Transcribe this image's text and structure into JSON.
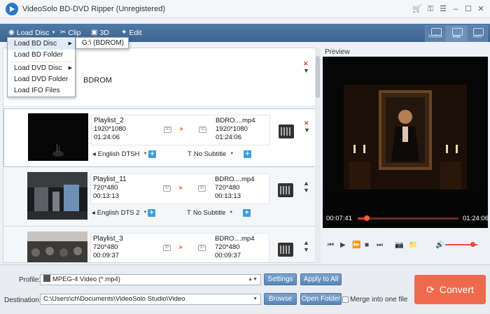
{
  "window": {
    "title": "VideoSolo BD-DVD Ripper (Unregistered)",
    "controls": [
      "cart-icon",
      "key-icon",
      "menu-icon",
      "minimize-icon",
      "maximize-icon",
      "close-icon"
    ]
  },
  "toolbar": {
    "load_disc": "Load Disc",
    "clip": "Clip",
    "three_d": "3D",
    "edit": "Edit",
    "accel": [
      {
        "label": "NVIDIA",
        "active": false
      },
      {
        "label": "Intel",
        "active": true
      },
      {
        "label": "AMD",
        "active": false
      }
    ]
  },
  "load_menu": {
    "items": [
      {
        "label": "Load BD Disc",
        "has_submenu": true
      },
      {
        "label": "Load BD Folder",
        "has_submenu": false
      },
      {
        "label": "Load DVD Disc",
        "has_submenu": true
      },
      {
        "label": "Load DVD Folder",
        "has_submenu": false
      },
      {
        "label": "Load IFO Files",
        "has_submenu": false
      }
    ],
    "submenu_item": "G:\\ (BDROM)"
  },
  "disc": {
    "label": "BDROM"
  },
  "titles": [
    {
      "name": "Playlist_2",
      "resolution": "1920*1080",
      "duration": "01:24:06",
      "out_name": "BDRO....mp4",
      "out_resolution": "1920*1080",
      "out_duration": "01:24:06",
      "audio": "English DTSH",
      "subtitle": "No Subtitle"
    },
    {
      "name": "Playlist_11",
      "resolution": "720*480",
      "duration": "00:13:13",
      "out_name": "BDRO....mp4",
      "out_resolution": "720*480",
      "out_duration": "00:13:13",
      "audio": "English DTS 2",
      "subtitle": "No Subtitle"
    },
    {
      "name": "Playlist_3",
      "resolution": "720*480",
      "duration": "00:09:37",
      "out_name": "BDRO....mp4",
      "out_resolution": "720*480",
      "out_duration": "00:09:37",
      "audio": "",
      "subtitle": ""
    }
  ],
  "preview": {
    "label": "Preview",
    "time_current": "00:07:41",
    "time_total": "01:24:06",
    "progress": 0.09,
    "volume": 0.85
  },
  "bottom": {
    "profile_label": "Profile:",
    "profile_value": "MPEG-4 Video (*.mp4)",
    "settings": "Settings",
    "apply_to_all": "Apply to All",
    "destination_label": "Destination:",
    "destination_value": "C:\\Users\\ch\\Documents\\VideoSolo Studio\\Video",
    "browse": "Browse",
    "open_folder": "Open Folder",
    "merge_label": "Merge into one file",
    "convert": "Convert"
  },
  "colors": {
    "toolbar": "#4a73a0",
    "accent_red": "#ef6a4c",
    "progress": "#e03a2a",
    "button_blue": "#6893c4"
  }
}
